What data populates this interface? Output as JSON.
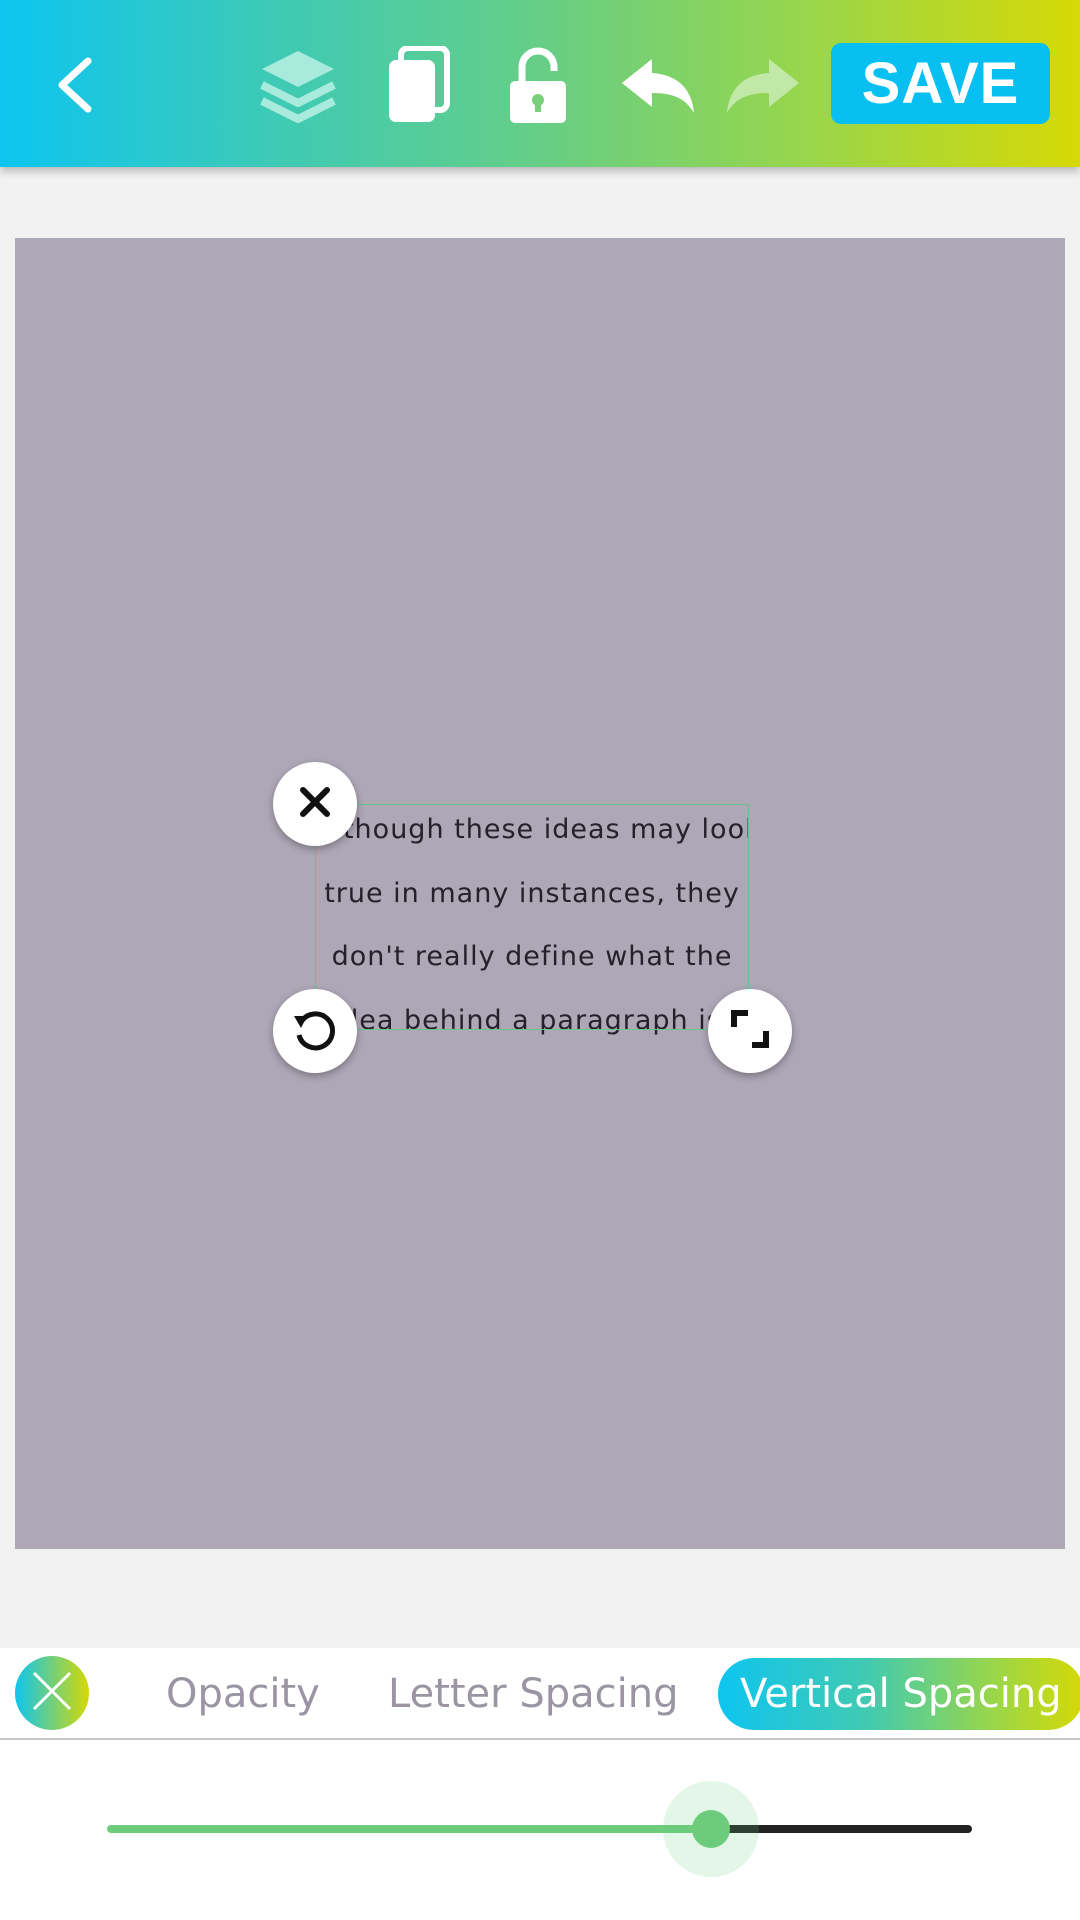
{
  "toolbar": {
    "save_label": "SAVE",
    "icons": [
      "back-icon",
      "layers-icon",
      "duplicate-icon",
      "unlock-icon",
      "undo-icon",
      "redo-icon"
    ],
    "redo_enabled": false
  },
  "canvas": {
    "background": "#aea7b6",
    "text_lines": [
      "Although these ideas may look",
      "true in many instances, they",
      "don't really define what the",
      "idea behind a paragraph is."
    ]
  },
  "tabs": {
    "items": [
      {
        "label": "Opacity",
        "active": false
      },
      {
        "label": "Letter Spacing",
        "active": false
      },
      {
        "label": "Vertical Spacing",
        "active": true
      }
    ]
  },
  "slider": {
    "value": 0.698,
    "fill_color": "#6ccc7c"
  },
  "colors": {
    "accent": "#07c0f1",
    "gradient_start": "#0dc5f0",
    "gradient_end": "#d6d905"
  }
}
